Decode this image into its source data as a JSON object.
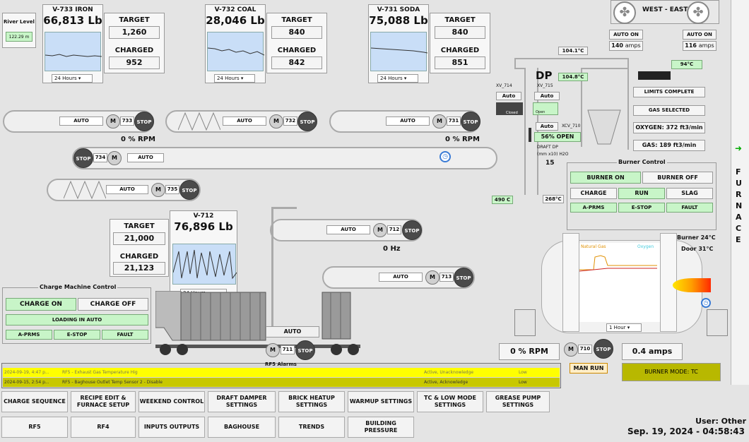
{
  "river": {
    "label": "River Level",
    "value": "122.29 m"
  },
  "hoppers": [
    {
      "title": "V-733 IRON",
      "value": "66,813 Lb",
      "target_label": "TARGET",
      "target": "1,260",
      "charged_label": "CHARGED",
      "charged": "952",
      "range": "24 Hours"
    },
    {
      "title": "V-732 COAL",
      "value": "28,046 Lb",
      "target_label": "TARGET",
      "target": "840",
      "charged_label": "CHARGED",
      "charged": "842",
      "range": "24 Hours"
    },
    {
      "title": "V-731 SODA",
      "value": "75,088 Lb",
      "target_label": "TARGET",
      "target": "840",
      "charged_label": "CHARGED",
      "charged": "851",
      "range": "24 Hours"
    }
  ],
  "v712": {
    "title": "V-712",
    "value": "76,896 Lb",
    "target_label": "TARGET",
    "target": "21,000",
    "charged_label": "CHARGED",
    "charged": "21,123",
    "range": "24 Hours"
  },
  "conveyors": {
    "c733": {
      "auto": "AUTO",
      "m": "M",
      "id": "733",
      "stop": "STOP",
      "rpm": "0 % RPM"
    },
    "c732": {
      "auto": "AUTO",
      "m": "M",
      "id": "732",
      "stop": "STOP"
    },
    "c731": {
      "auto": "AUTO",
      "m": "M",
      "id": "731",
      "stop": "STOP",
      "rpm": "0 % RPM"
    },
    "c734": {
      "auto": "AUTO",
      "m": "M",
      "id": "734",
      "stop": "STOP"
    },
    "c735": {
      "auto": "AUTO",
      "m": "M",
      "id": "735",
      "stop": "STOP"
    },
    "c712": {
      "auto": "AUTO",
      "m": "M",
      "id": "712",
      "stop": "STOP",
      "hz": "0 Hz"
    },
    "c713": {
      "auto": "AUTO",
      "m": "M",
      "id": "713",
      "stop": "STOP"
    },
    "c711": {
      "auto": "AUTO",
      "m": "M",
      "id": "711",
      "stop": "STOP"
    },
    "c710": {
      "m": "M",
      "id": "710",
      "stop": "STOP",
      "rpm": "0 % RPM",
      "amps": "0.4 amps",
      "man_run": "MAN RUN"
    }
  },
  "charge_machine": {
    "title": "Charge Machine Control",
    "on": "CHARGE ON",
    "off": "CHARGE OFF",
    "loading": "LOADING IN AUTO",
    "aprms": "A-PRMS",
    "estop": "E-STOP",
    "fault": "FAULT"
  },
  "fans": {
    "title": "WEST - EAST",
    "left_mode": "AUTO ON",
    "left_amps": "140",
    "right_mode": "AUTO ON",
    "right_amps": "116",
    "unit": "amps",
    "temp": "94°C"
  },
  "dp": {
    "label": "DP",
    "t1": "104.1°C",
    "t2": "104.8°C",
    "xv714": "XV_714",
    "xv715": "XV_715",
    "auto": "Auto",
    "closed": "Closed",
    "open": "Open",
    "xcv": "XCV_710",
    "xcv_auto": "Auto",
    "xcv_open": "56% OPEN",
    "draft_label": "DRAFT DP",
    "draft_unit": "(mm x10) H2O",
    "draft_val": "15",
    "t490": "490 C",
    "t268": "268°C"
  },
  "status": {
    "limits": "LIMITS COMPLETE",
    "gas": "GAS SELECTED",
    "oxygen_label": "OXYGEN:",
    "oxygen_val": "372",
    "oxygen_unit": "ft3/min",
    "gas_label": "GAS:",
    "gas_val": "189",
    "gas_unit": "ft3/min"
  },
  "burner": {
    "title": "Burner Control",
    "on": "BURNER ON",
    "off": "BURNER OFF",
    "charge": "CHARGE",
    "run": "RUN",
    "slag": "SLAG",
    "aprms": "A-PRMS",
    "estop": "E-STOP",
    "fault": "FAULT",
    "burner_temp": "Burner 24°C",
    "door_temp": "Door 31°C",
    "legend_gas": "Natural Gas",
    "legend_oxy": "Oxygen",
    "range": "1 Hour",
    "mode": "BURNER MODE: TC"
  },
  "furnace": {
    "label": "FURNACE",
    "arrow": "➜"
  },
  "alarms": {
    "title": "RF5 Alarms",
    "rows": [
      {
        "time": "2024-09-19, 4:47 p...",
        "text": "RF5 - Exhaust Gas Temperature Hig",
        "state": "Active, Unacknowledge",
        "prio": "Low"
      },
      {
        "time": "2024-09-15, 2:54 p...",
        "text": "RF5 - Baghouse Outlet Temp Sensor 2 - Disable",
        "state": "Active, Acknowledge",
        "prio": "Low"
      }
    ]
  },
  "nav": {
    "row1": [
      "CHARGE SEQUENCE",
      "RECIPE EDIT & FURNACE SETUP",
      "WEEKEND CONTROL",
      "DRAFT DAMPER SETTINGS",
      "BRICK HEATUP SETTINGS",
      "WARMUP SETTINGS",
      "TC & LOW MODE SETTINGS",
      "GREASE PUMP SETTINGS"
    ],
    "row2": [
      "RF5",
      "RF4",
      "INPUTS OUTPUTS",
      "BAGHOUSE",
      "TRENDS",
      "BUILDING PRESSURE"
    ]
  },
  "footer": {
    "user": "User: Other",
    "datetime": "Sep. 19, 2024 - 04:58:43"
  },
  "colors": {
    "alarm_unack": "#ffff00",
    "alarm_ack": "#c8c800",
    "green_btn": "#c8f5c8",
    "burner_mode": "#b8b800"
  }
}
